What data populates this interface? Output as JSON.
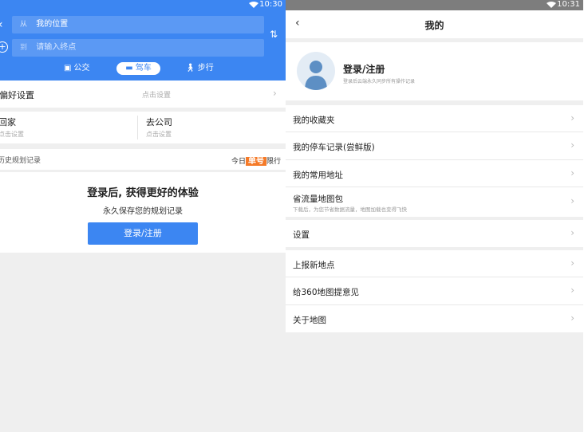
{
  "left": {
    "status": {
      "time": "10:30"
    },
    "route": {
      "from_tag": "从",
      "from_value": "我的位置",
      "to_tag": "到",
      "to_placeholder": "请输入终点"
    },
    "modes": {
      "bus": "公交",
      "drive": "驾车",
      "walk": "步行",
      "active": "drive"
    },
    "preference": {
      "label": "偏好设置",
      "hint": "点击设置"
    },
    "home": {
      "title": "回家",
      "sub": "点击设置"
    },
    "work": {
      "title": "去公司",
      "sub": "点击设置"
    },
    "history": {
      "label": "历史规划记录",
      "limit_prefix": "今日",
      "limit_badge": "单号",
      "limit_suffix": "限行"
    },
    "login_promo": {
      "title": "登录后, 获得更好的体验",
      "subtitle": "永久保存您的规划记录",
      "button": "登录/注册"
    }
  },
  "right": {
    "status": {
      "time": "10:31"
    },
    "header": {
      "title": "我的"
    },
    "profile": {
      "name": "登录/注册",
      "sub": "登录后云端永久同步所有操作记录"
    },
    "menu": [
      {
        "label": "我的收藏夹"
      },
      {
        "label": "我的停车记录(尝鲜版)"
      },
      {
        "label": "我的常用地址"
      },
      {
        "label": "省流量地图包",
        "sub": "下载后，为您节省数据流量，地图加载也变得飞快"
      },
      {
        "label": "设置"
      },
      {
        "label": "上报新地点"
      },
      {
        "label": "给360地图提意见"
      },
      {
        "label": "关于地图"
      }
    ]
  },
  "colors": {
    "primary": "#3c86f2",
    "badge": "#f57a28",
    "background": "#efefef"
  },
  "icons": [
    "wifi-icon",
    "back-arrow-icon",
    "plus-icon",
    "swap-icon",
    "bus-icon",
    "car-icon",
    "walk-icon",
    "chevron-right-icon",
    "avatar-icon"
  ]
}
